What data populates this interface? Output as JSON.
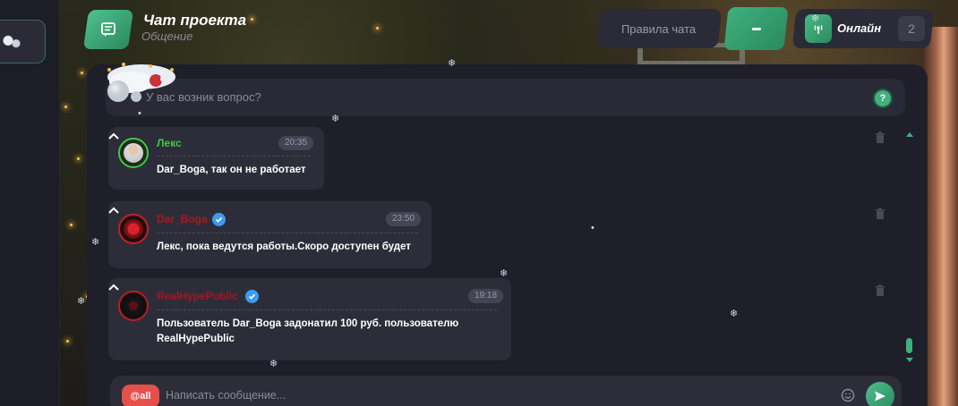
{
  "header": {
    "title": "Чат проекта",
    "subtitle": "Общение",
    "rules_label": "Правила чата",
    "online_label": "Онлайн",
    "online_count": "2"
  },
  "faq": {
    "text": "У вас возник вопрос?",
    "help_label": "?"
  },
  "messages": [
    {
      "user": "Лекс",
      "user_color": "#3ec93e",
      "time": "20:35",
      "text": "Dar_Boga, так он не работает",
      "verified": false
    },
    {
      "user": "Dar_Boga",
      "user_color": "#b3141b",
      "time": "23:50",
      "text": "Лекс, пока ведутся работы.Скоро доступен будет",
      "verified": true
    },
    {
      "user": "RealHypePublic",
      "user_color": "#a01820",
      "time": "19:18",
      "text": "Пользователь Dar_Boga задонатил 100 руб. пользователю RealHypePublic",
      "verified": true
    }
  ],
  "input": {
    "mention_label": "@all",
    "placeholder": "Написать сообщение..."
  },
  "colors": {
    "accent": "#3fb07d",
    "panel": "#1f1f2a",
    "bubble": "#2d2d3a",
    "mention": "#e4504c",
    "verified": "#3d9bf0"
  },
  "icons": [
    "chat-icon",
    "minus-icon",
    "antenna-icon",
    "help-icon",
    "trash-icon",
    "smile-icon",
    "send-icon",
    "snowflake-icon"
  ]
}
